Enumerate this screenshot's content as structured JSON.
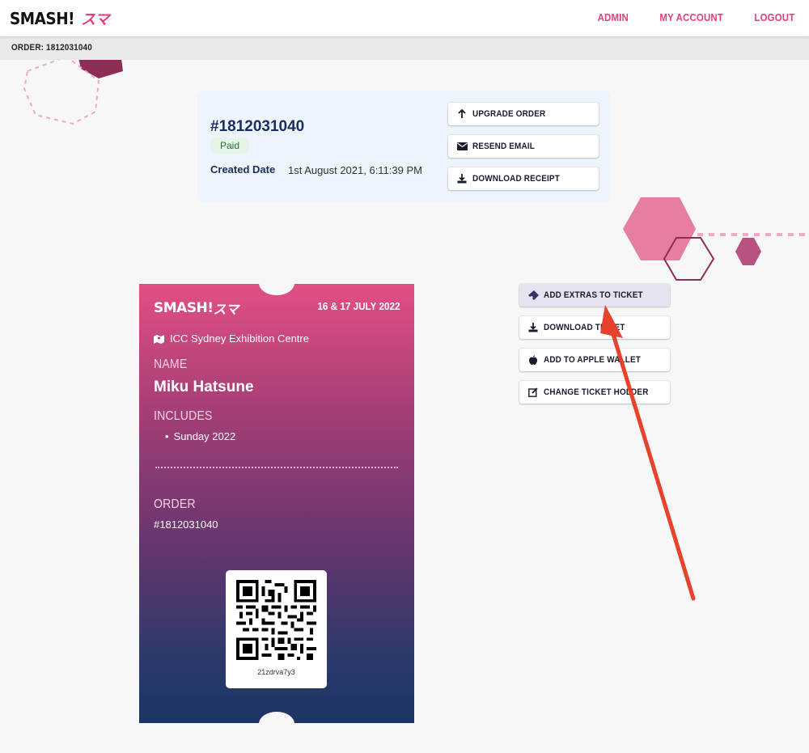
{
  "header": {
    "logo_text": "SMASH!",
    "logo_jp": "スマ",
    "nav": [
      "ADMIN",
      "MY ACCOUNT",
      "LOGOUT"
    ]
  },
  "breadcrumb": {
    "text": "ORDER: 1812031040"
  },
  "order": {
    "number": "#1812031040",
    "status": "Paid",
    "created_label": "Created Date",
    "created_value": "1st August 2021, 6:11:39 PM",
    "buttons": [
      {
        "label": "UPGRADE ORDER",
        "icon": "arrow-up-icon"
      },
      {
        "label": "RESEND EMAIL",
        "icon": "envelope-icon"
      },
      {
        "label": "DOWNLOAD RECEIPT",
        "icon": "download-icon"
      }
    ]
  },
  "ticket": {
    "logo_text": "SMASH!",
    "logo_jp": "スマ",
    "dates": "16 & 17 JULY 2022",
    "venue": "ICC Sydney Exhibition Centre",
    "name_label": "NAME",
    "name": "Miku Hatsune",
    "includes_label": "INCLUDES",
    "includes": [
      "Sunday 2022"
    ],
    "order_label": "ORDER",
    "order_number": "#1812031040",
    "qr_code_text": "21zdrva7y3"
  },
  "ticket_actions": [
    {
      "label": "ADD EXTRAS TO TICKET",
      "icon": "ticket-icon"
    },
    {
      "label": "DOWNLOAD TICKET",
      "icon": "download-icon"
    },
    {
      "label": "ADD TO APPLE WALLET",
      "icon": "apple-icon"
    },
    {
      "label": "CHANGE TICKET HOLDER",
      "icon": "edit-icon"
    }
  ],
  "colors": {
    "brand_pink": "#e23e7d",
    "annotation_arrow": "#e8412c"
  }
}
